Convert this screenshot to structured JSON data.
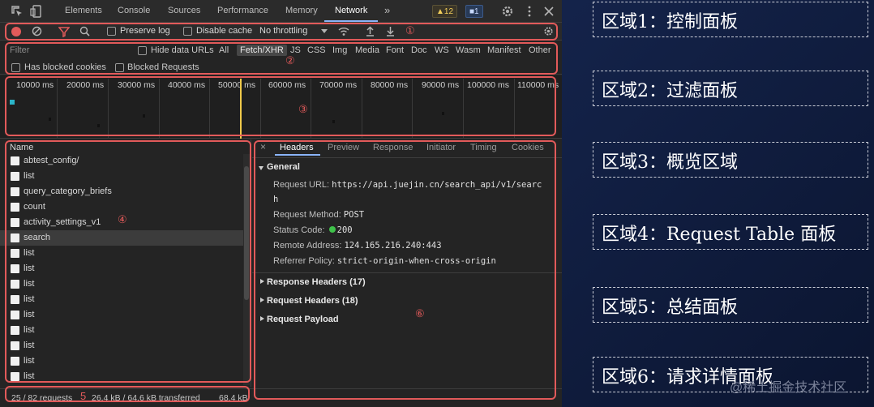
{
  "tabbar": {
    "tabs": [
      "Elements",
      "Console",
      "Sources",
      "Performance",
      "Memory",
      "Network"
    ],
    "active_tab": "Network",
    "more": "»",
    "warning_count": "▲12",
    "info_count": "■1"
  },
  "controls": {
    "preserve_log": "Preserve log",
    "disable_cache": "Disable cache",
    "throttling": "No throttling"
  },
  "filter": {
    "placeholder": "Filter",
    "hide_data_urls": "Hide data URLs",
    "types": [
      "All",
      "Fetch/XHR",
      "JS",
      "CSS",
      "Img",
      "Media",
      "Font",
      "Doc",
      "WS",
      "Wasm",
      "Manifest",
      "Other"
    ],
    "selected_type": "Fetch/XHR",
    "has_blocked_cookies": "Has blocked cookies",
    "blocked_requests": "Blocked Requests"
  },
  "overview": {
    "ticks": [
      "10000 ms",
      "20000 ms",
      "30000 ms",
      "40000 ms",
      "50000 ms",
      "60000 ms",
      "70000 ms",
      "80000 ms",
      "90000 ms",
      "100000 ms",
      "110000 ms"
    ]
  },
  "requests": {
    "header": "Name",
    "items": [
      "abtest_config/",
      "list",
      "query_category_briefs",
      "count",
      "activity_settings_v1",
      "search",
      "list",
      "list",
      "list",
      "list",
      "list",
      "list",
      "list",
      "list",
      "list"
    ],
    "selected": "search"
  },
  "details": {
    "close": "×",
    "tabs": [
      "Headers",
      "Preview",
      "Response",
      "Initiator",
      "Timing",
      "Cookies"
    ],
    "active_tab": "Headers",
    "general_title": "General",
    "request_url_label": "Request URL:",
    "request_url_line1": "https://api.juejin.cn/search_api/v1/searc",
    "request_url_line2": "h",
    "method_label": "Request Method:",
    "method_value": "POST",
    "status_label": "Status Code:",
    "status_value": "200",
    "remote_label": "Remote Address:",
    "remote_value": "124.165.216.240:443",
    "referrer_label": "Referrer Policy:",
    "referrer_value": "strict-origin-when-cross-origin",
    "response_headers": "Response Headers (17)",
    "request_headers": "Request Headers (18)",
    "request_payload": "Request Payload"
  },
  "status": {
    "requests": "25 / 82 requests",
    "transferred": "26.4 kB / 64.6 kB transferred",
    "resources": "68.4 kB"
  },
  "markers": [
    "①",
    "②",
    "③",
    "④",
    "5",
    "⑥"
  ],
  "legend": [
    "区域1：控制面板",
    "区域2：过滤面板",
    "区域3：概览区域",
    "区域4：Request Table 面板",
    "区域5：总结面板",
    "区域6：请求详情面板"
  ],
  "watermark": "@稀土掘金技术社区",
  "colors": {
    "highlight": "#e25a5a",
    "record": "#e25a5a",
    "status_ok": "#3fc24a",
    "accent": "#8ab4f8",
    "timeline_cursor": "#f0c94a"
  }
}
